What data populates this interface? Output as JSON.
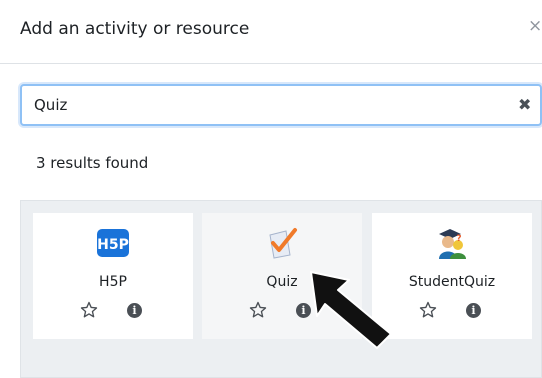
{
  "modal": {
    "title": "Add an activity or resource",
    "close_glyph": "×"
  },
  "search": {
    "value": "Quiz",
    "clear_glyph": "✖"
  },
  "results": {
    "count_text": "3 results found",
    "items": [
      {
        "label": "H5P",
        "icon": "h5p-icon",
        "starred": false
      },
      {
        "label": "Quiz",
        "icon": "quiz-checkmark-icon",
        "starred": false
      },
      {
        "label": "StudentQuiz",
        "icon": "studentquiz-icon",
        "starred": false
      }
    ]
  },
  "colors": {
    "h5p_blue": "#1a73d9",
    "quiz_check": "#f07a2a",
    "focus_border": "#8fc1f5",
    "panel_bg": "#eceff2"
  },
  "info_glyph": "i"
}
